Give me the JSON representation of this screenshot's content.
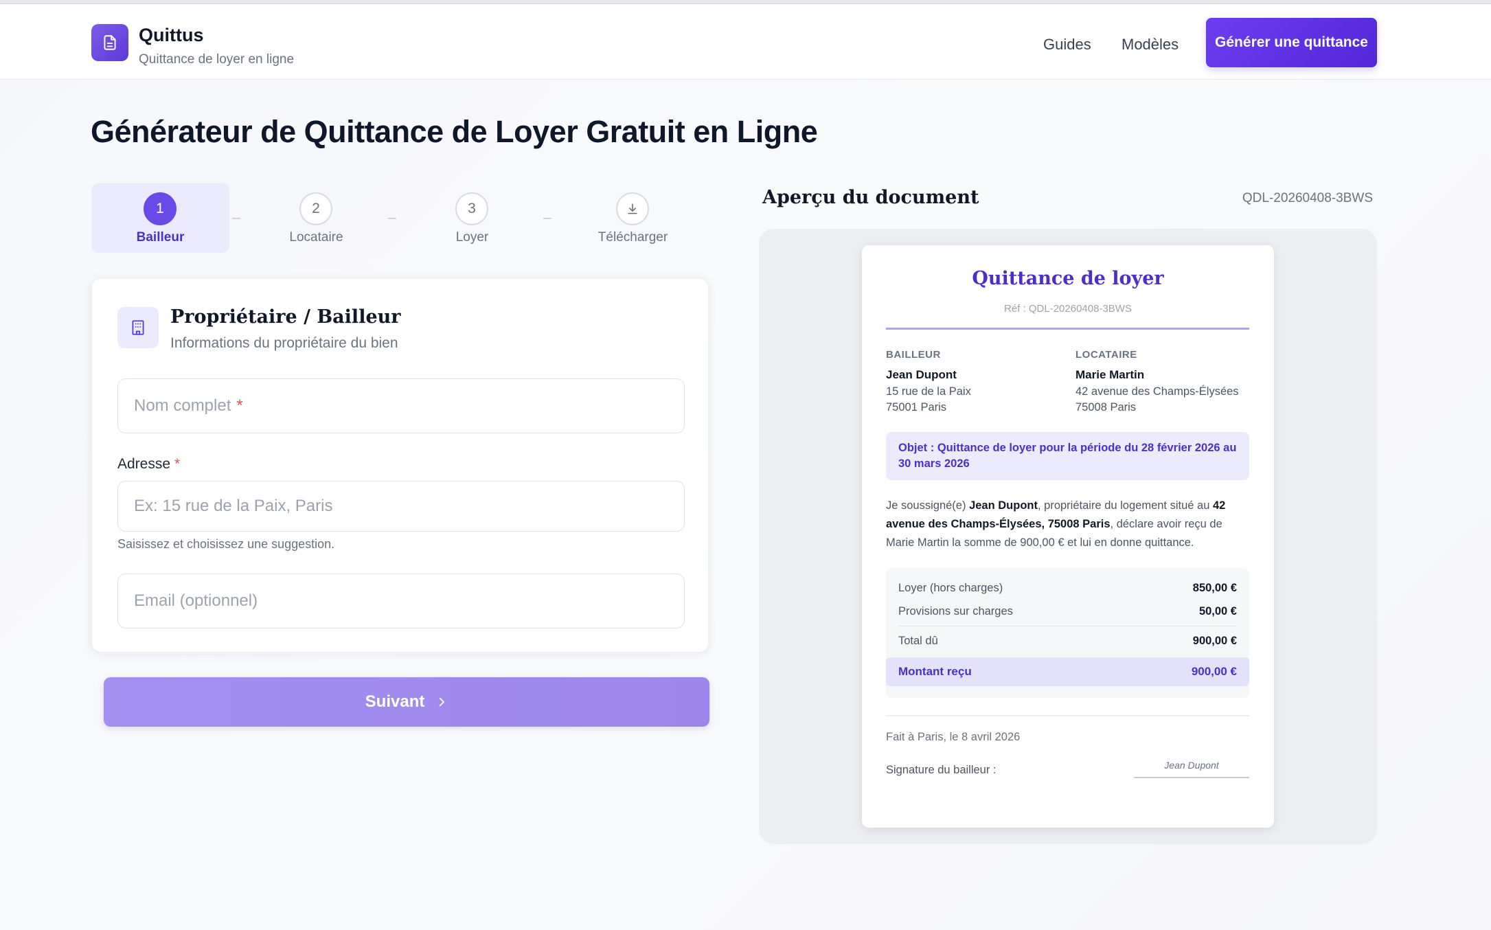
{
  "header": {
    "brand_name": "Quittus",
    "brand_tagline": "Quittance de loyer en ligne",
    "nav": {
      "guides": "Guides",
      "modeles": "Modèles"
    },
    "cta_label": "Générer une quittance"
  },
  "page_title": "Générateur de Quittance de Loyer Gratuit en Ligne",
  "stepper": {
    "steps": [
      {
        "number": "1",
        "label": "Bailleur",
        "active": true
      },
      {
        "number": "2",
        "label": "Locataire",
        "active": false
      },
      {
        "number": "3",
        "label": "Loyer",
        "active": false
      },
      {
        "number": "",
        "label": "Télécharger",
        "active": false,
        "icon": "download-icon"
      }
    ]
  },
  "form": {
    "icon": "building-icon",
    "title": "Propriétaire / Bailleur",
    "subtitle": "Informations du propriétaire du bien",
    "nom_placeholder": "Nom complet",
    "required_mark": "*",
    "adresse_label": "Adresse",
    "adresse_placeholder": "Ex: 15 rue de la Paix, Paris",
    "adresse_hint": "Saisissez et choisissez une suggestion.",
    "email_placeholder": "Email (optionnel)"
  },
  "next_button": {
    "label": "Suivant",
    "icon": "chevron-right-icon"
  },
  "preview": {
    "title": "Aperçu du document",
    "reference": "QDL-20260408-3BWS",
    "document": {
      "title": "Quittance de loyer",
      "ref_line": "Réf : QDL-20260408-3BWS",
      "bailleur": {
        "heading": "BAILLEUR",
        "name": "Jean Dupont",
        "address_line1": "15 rue de la Paix",
        "address_line2": "75001 Paris"
      },
      "locataire": {
        "heading": "LOCATAIRE",
        "name": "Marie Martin",
        "address_line1": "42 avenue des Champs-Élysées",
        "address_line2": "75008 Paris"
      },
      "objet": "Objet : Quittance de loyer pour la période du 28 février 2026 au 30 mars 2026",
      "body": {
        "part1": "Je soussigné(e) ",
        "bailleur_name": "Jean Dupont",
        "part2": ", propriétaire du logement situé au ",
        "logement_address": "42 avenue des Champs-Élysées, 75008 Paris",
        "part3": ", déclare avoir reçu de Marie Martin la somme de 900,00 € et lui en donne quittance."
      },
      "amounts": [
        {
          "label": "Loyer (hors charges)",
          "value": "850,00 €"
        },
        {
          "label": "Provisions sur charges",
          "value": "50,00 €"
        },
        {
          "label": "Total dû",
          "value": "900,00 €"
        }
      ],
      "montant_recu": {
        "label": "Montant reçu",
        "value": "900,00 €"
      },
      "fait_a": "Fait à Paris, le 8 avril 2026",
      "signature_label": "Signature du bailleur :",
      "signature_name": "Jean Dupont"
    }
  },
  "colors": {
    "accent": "#5b3bd6",
    "accent_light": "#ecebfd",
    "required": "#e05252"
  }
}
